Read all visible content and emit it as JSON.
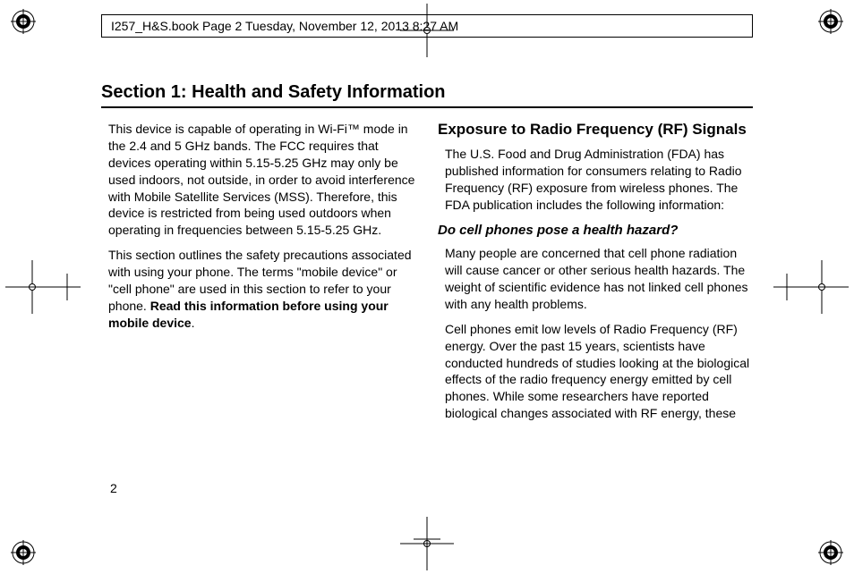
{
  "header": {
    "text": "I257_H&S.book  Page 2  Tuesday, November 12, 2013  8:27 AM"
  },
  "section": {
    "title": "Section 1: Health and Safety Information"
  },
  "colLeft": {
    "p1_pre": "This device is capable of operating in Wi-Fi™ mode in the 2.4 and 5 GHz bands. The FCC requires that devices operating within 5.15-5.25 GHz may only be used indoors, not outside, in order to avoid interference with Mobile Satellite Services (MSS). Therefore, this device is restricted from being used outdoors when operating in frequencies between 5.15-5.25 GHz.",
    "p2_pre": "This section outlines the safety precautions associated with using your phone. The terms \"mobile device\" or \"cell phone\" are used in this section to refer to your phone. ",
    "p2_bold": "Read this information before using your mobile device",
    "p2_post": "."
  },
  "colRight": {
    "h1": "Exposure to Radio Frequency (RF) Signals",
    "p1": "The U.S. Food and Drug Administration (FDA) has published information for consumers relating to Radio Frequency (RF) exposure from wireless phones. The FDA publication includes the following information:",
    "h2": "Do cell phones pose a health hazard?",
    "p2": "Many people are concerned that cell phone radiation will cause cancer or other serious health hazards. The weight of scientific evidence has not linked cell phones with any health problems.",
    "p3": "Cell phones emit low levels of Radio Frequency (RF) energy. Over the past 15 years, scientists have conducted hundreds of studies looking at the biological effects of the radio frequency energy emitted by cell phones. While some researchers have reported biological changes associated with RF energy, these"
  },
  "pageNumber": "2"
}
